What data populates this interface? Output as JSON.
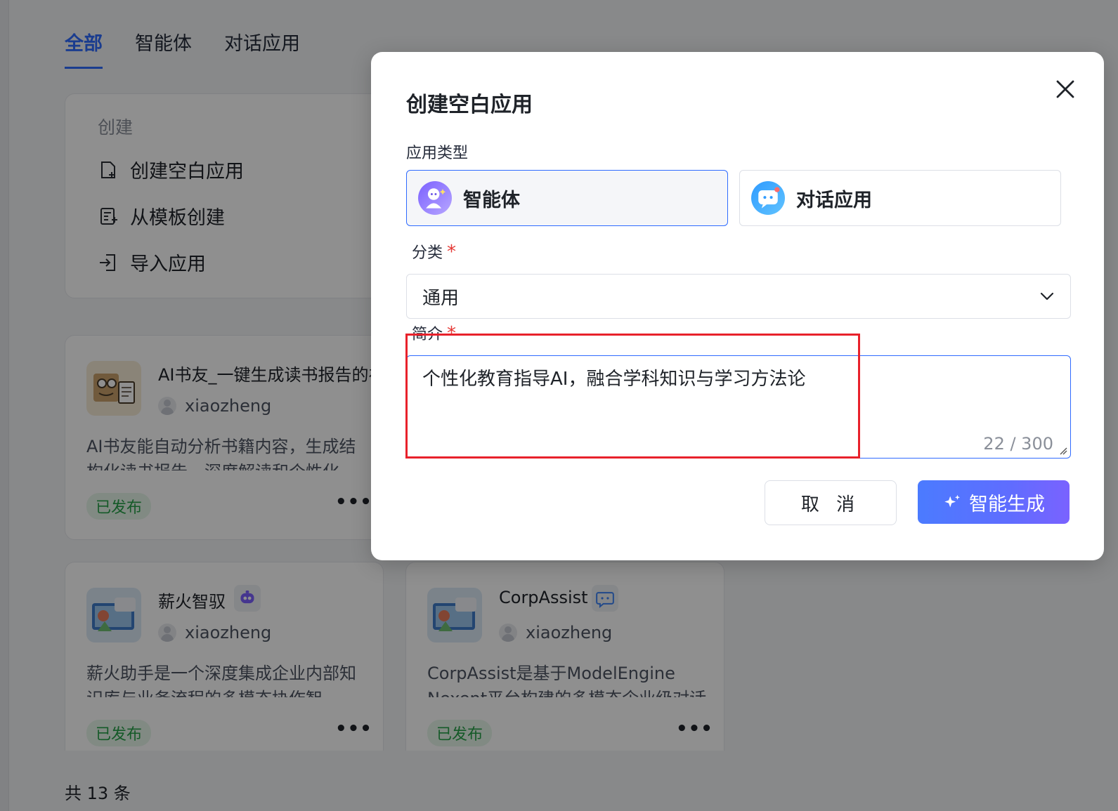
{
  "tabs": [
    {
      "label": "全部",
      "active": true
    },
    {
      "label": "智能体",
      "active": false
    },
    {
      "label": "对话应用",
      "active": false
    }
  ],
  "create_panel": {
    "title": "创建",
    "items": [
      {
        "label": "创建空白应用",
        "icon": "new-file-icon"
      },
      {
        "label": "从模板创建",
        "icon": "template-icon"
      },
      {
        "label": "导入应用",
        "icon": "import-icon"
      }
    ]
  },
  "apps": [
    {
      "name": "AI书友_一键生成读书报告的礼",
      "author": "xiaozheng",
      "desc": "AI书友能自动分析书籍内容，生成结构化读书报告，深度解读和个性化",
      "status": "已发布",
      "more": "•••"
    },
    {
      "name": "薪火智驭",
      "author": "xiaozheng",
      "desc": "薪火助手是一个深度集成企业内部知识库与业务流程的多模态协作智",
      "status": "已发布",
      "more": "•••",
      "type_icon": "robot-icon"
    },
    {
      "name": "CorpAssist",
      "author": "xiaozheng",
      "desc": "CorpAssist是基于ModelEngine Nexent平台构建的多模态企业级对话",
      "status": "已发布",
      "more": "•••",
      "type_icon": "chat-icon"
    }
  ],
  "pagination": {
    "total_label": "共 13 条"
  },
  "modal": {
    "title": "创建空白应用",
    "type_label": "应用类型",
    "type_options": [
      {
        "label": "智能体",
        "selected": true
      },
      {
        "label": "对话应用",
        "selected": false
      }
    ],
    "category_label": "分类",
    "category_required": "*",
    "category_value": "通用",
    "intro_label": "简介",
    "intro_required": "*",
    "intro_value": "个性化教育指导AI，融合学科知识与学习方法论",
    "intro_counter": "22 / 300",
    "cancel_label": "取 消",
    "generate_label": "智能生成"
  },
  "colors": {
    "accent": "#2f6bff",
    "published_badge": "#26a048",
    "required": "#e53935",
    "highlight": "#e8212b"
  }
}
